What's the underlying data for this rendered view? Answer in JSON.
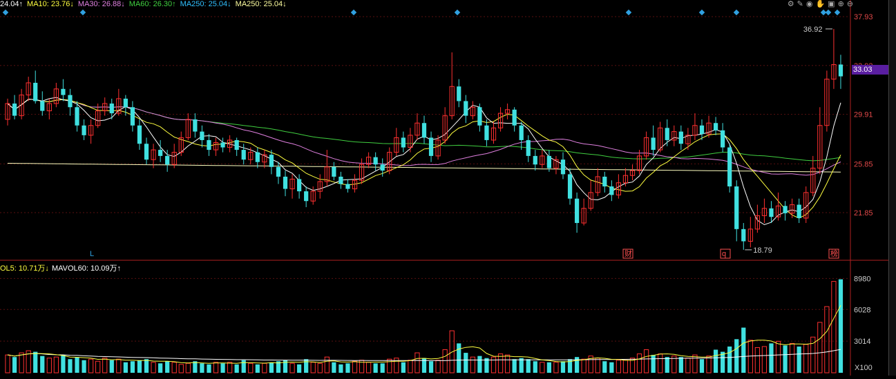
{
  "ma_legend": [
    {
      "text": "24.04↑",
      "color": "#ffffff"
    },
    {
      "text": "MA10: 23.76↓",
      "color": "#ffff40"
    },
    {
      "text": "MA30: 26.88↓",
      "color": "#e080e0"
    },
    {
      "text": "MA60: 26.30↑",
      "color": "#40d040"
    },
    {
      "text": "MA250: 25.04↓",
      "color": "#30c0ff"
    },
    {
      "text": "MA250: 25.04↓",
      "color": "#ffffa0"
    }
  ],
  "vol_legend": [
    {
      "text": "OL5: 10.71万↓",
      "color": "#ffff40"
    },
    {
      "text": "MAVOL60: 10.09万↑",
      "color": "#ffffff"
    }
  ],
  "chart_data": {
    "type": "candlestick",
    "y_ticks": [
      "37.93",
      "33.92",
      "29.91",
      "25.85",
      "21.85"
    ],
    "current_price": "33.03",
    "high_marker": "36.92",
    "low_marker": "18.79",
    "event_labels": [
      "L",
      "财",
      "q",
      "榜"
    ],
    "volume_ticks": [
      "8980",
      "6028",
      "3014"
    ],
    "volume_unit": "X100",
    "candles": [
      [
        29.5,
        30.8,
        31.2,
        29.0
      ],
      [
        30.8,
        29.8,
        31.5,
        29.5
      ],
      [
        29.8,
        31.5,
        32.0,
        29.5
      ],
      [
        31.5,
        32.5,
        33.0,
        31.0
      ],
      [
        32.5,
        31.0,
        33.5,
        30.8
      ],
      [
        31.0,
        30.2,
        31.8,
        29.8
      ],
      [
        30.2,
        30.8,
        31.2,
        29.5
      ],
      [
        30.8,
        32.0,
        32.5,
        30.5
      ],
      [
        32.0,
        31.5,
        32.8,
        31.0
      ],
      [
        31.5,
        30.5,
        32.0,
        29.8
      ],
      [
        30.5,
        29.0,
        31.0,
        28.5
      ],
      [
        29.0,
        28.2,
        29.5,
        27.8
      ],
      [
        28.2,
        29.0,
        29.5,
        27.5
      ],
      [
        29.0,
        30.2,
        30.8,
        28.8
      ],
      [
        30.2,
        30.8,
        31.3,
        29.8
      ],
      [
        30.8,
        30.0,
        31.2,
        29.5
      ],
      [
        30.0,
        31.2,
        32.0,
        29.8
      ],
      [
        31.2,
        30.5,
        31.5,
        29.8
      ],
      [
        30.5,
        29.0,
        31.0,
        28.5
      ],
      [
        29.0,
        27.5,
        29.5,
        27.0
      ],
      [
        27.5,
        26.2,
        28.0,
        25.8
      ],
      [
        26.2,
        27.0,
        27.5,
        25.5
      ],
      [
        27.0,
        26.5,
        27.8,
        26.0
      ],
      [
        26.5,
        25.8,
        27.0,
        25.2
      ],
      [
        25.8,
        26.8,
        27.5,
        25.5
      ],
      [
        26.8,
        28.0,
        28.5,
        26.5
      ],
      [
        28.0,
        29.5,
        30.0,
        27.8
      ],
      [
        29.5,
        28.5,
        30.0,
        28.0
      ],
      [
        28.5,
        27.8,
        29.0,
        27.2
      ],
      [
        27.8,
        27.0,
        28.3,
        26.5
      ],
      [
        27.0,
        27.6,
        28.0,
        26.5
      ],
      [
        27.6,
        27.2,
        28.0,
        26.8
      ],
      [
        27.2,
        27.8,
        28.2,
        26.8
      ],
      [
        27.8,
        27.0,
        28.0,
        26.5
      ],
      [
        27.0,
        26.2,
        27.5,
        25.8
      ],
      [
        26.2,
        26.8,
        27.2,
        25.8
      ],
      [
        26.8,
        26.0,
        27.2,
        25.5
      ],
      [
        26.0,
        26.6,
        27.0,
        25.5
      ],
      [
        26.6,
        25.6,
        27.0,
        25.0
      ],
      [
        25.6,
        24.8,
        26.0,
        24.2
      ],
      [
        24.8,
        23.8,
        25.3,
        23.2
      ],
      [
        23.8,
        24.6,
        25.0,
        23.0
      ],
      [
        24.6,
        23.6,
        25.0,
        23.0
      ],
      [
        23.6,
        22.8,
        24.0,
        22.3
      ],
      [
        22.8,
        23.6,
        24.0,
        22.5
      ],
      [
        23.6,
        24.4,
        25.0,
        23.0
      ],
      [
        24.4,
        25.6,
        27.0,
        24.0
      ],
      [
        25.6,
        24.8,
        26.0,
        24.5
      ],
      [
        24.8,
        24.2,
        25.2,
        23.8
      ],
      [
        24.2,
        23.8,
        24.6,
        23.5
      ],
      [
        23.8,
        24.5,
        25.0,
        23.5
      ],
      [
        24.5,
        25.8,
        26.3,
        24.2
      ],
      [
        25.8,
        26.4,
        26.8,
        25.5
      ],
      [
        26.4,
        25.8,
        26.8,
        25.3
      ],
      [
        25.8,
        25.3,
        26.3,
        24.8
      ],
      [
        25.3,
        26.8,
        27.2,
        25.0
      ],
      [
        26.8,
        28.0,
        28.8,
        26.5
      ],
      [
        28.0,
        27.2,
        28.5,
        26.8
      ],
      [
        27.2,
        28.2,
        28.8,
        26.8
      ],
      [
        28.2,
        29.2,
        30.0,
        27.8
      ],
      [
        29.2,
        28.0,
        29.8,
        27.5
      ],
      [
        28.0,
        26.5,
        28.5,
        26.0
      ],
      [
        26.5,
        27.8,
        28.2,
        26.2
      ],
      [
        27.8,
        29.8,
        30.5,
        27.5
      ],
      [
        29.8,
        32.2,
        35.0,
        29.5
      ],
      [
        32.2,
        31.0,
        32.8,
        30.5
      ],
      [
        31.0,
        29.8,
        31.5,
        29.2
      ],
      [
        29.8,
        30.5,
        31.0,
        29.5
      ],
      [
        30.5,
        29.0,
        30.8,
        28.5
      ],
      [
        29.0,
        27.8,
        29.5,
        27.3
      ],
      [
        27.8,
        28.8,
        29.3,
        27.5
      ],
      [
        28.8,
        30.0,
        30.5,
        28.5
      ],
      [
        30.0,
        30.3,
        30.8,
        29.5
      ],
      [
        30.3,
        29.0,
        30.5,
        28.5
      ],
      [
        29.0,
        27.8,
        29.3,
        27.0
      ],
      [
        27.8,
        26.5,
        28.2,
        26.0
      ],
      [
        26.5,
        25.8,
        27.0,
        25.3
      ],
      [
        25.8,
        26.5,
        27.0,
        25.5
      ],
      [
        26.5,
        25.5,
        27.0,
        25.2
      ],
      [
        25.5,
        26.2,
        26.5,
        25.0
      ],
      [
        26.2,
        25.0,
        26.8,
        24.6
      ],
      [
        25.0,
        23.0,
        25.5,
        22.5
      ],
      [
        23.0,
        21.0,
        23.5,
        20.2
      ],
      [
        21.0,
        22.2,
        23.0,
        20.8
      ],
      [
        22.2,
        23.5,
        24.5,
        22.0
      ],
      [
        23.5,
        24.8,
        25.5,
        23.2
      ],
      [
        24.8,
        24.0,
        25.2,
        23.5
      ],
      [
        24.0,
        23.3,
        24.5,
        22.8
      ],
      [
        23.3,
        24.3,
        25.0,
        23.0
      ],
      [
        24.3,
        24.9,
        25.5,
        24.0
      ],
      [
        24.9,
        25.3,
        25.8,
        24.5
      ],
      [
        25.3,
        26.5,
        27.0,
        25.0
      ],
      [
        26.5,
        28.0,
        28.5,
        26.2
      ],
      [
        28.0,
        27.0,
        29.0,
        26.5
      ],
      [
        27.0,
        28.8,
        29.3,
        26.8
      ],
      [
        28.8,
        27.8,
        29.5,
        27.3
      ],
      [
        27.8,
        28.5,
        29.0,
        27.3
      ],
      [
        28.5,
        27.5,
        29.0,
        27.0
      ],
      [
        27.5,
        28.2,
        28.8,
        27.0
      ],
      [
        28.2,
        29.0,
        30.0,
        27.8
      ],
      [
        29.0,
        28.3,
        29.5,
        27.8
      ],
      [
        28.3,
        29.2,
        29.8,
        28.0
      ],
      [
        29.2,
        28.6,
        29.7,
        28.2
      ],
      [
        28.6,
        27.2,
        29.2,
        26.8
      ],
      [
        27.2,
        24.0,
        27.5,
        23.5
      ],
      [
        24.0,
        20.5,
        24.5,
        19.5
      ],
      [
        20.5,
        19.5,
        21.0,
        18.8
      ],
      [
        19.5,
        20.5,
        21.5,
        19.0
      ],
      [
        20.5,
        21.6,
        22.5,
        20.2
      ],
      [
        21.6,
        22.2,
        23.0,
        21.0
      ],
      [
        22.2,
        21.5,
        22.8,
        21.0
      ],
      [
        21.5,
        22.4,
        23.5,
        21.2
      ],
      [
        22.4,
        21.8,
        22.8,
        21.2
      ],
      [
        21.8,
        22.5,
        23.0,
        21.4
      ],
      [
        22.5,
        21.4,
        23.0,
        21.0
      ],
      [
        21.4,
        23.5,
        24.0,
        21.0
      ],
      [
        23.5,
        25.5,
        26.5,
        23.2
      ],
      [
        25.5,
        29.0,
        30.5,
        25.0
      ],
      [
        29.0,
        32.8,
        33.5,
        28.5
      ],
      [
        32.8,
        34.0,
        36.92,
        32.0
      ],
      [
        34.0,
        33.03,
        34.8,
        32.0
      ]
    ],
    "volumes": [
      1700,
      1500,
      1900,
      2100,
      2000,
      1600,
      1400,
      1500,
      1700,
      1300,
      1500,
      1200,
      1300,
      1100,
      1400,
      1200,
      1300,
      1000,
      1100,
      1200,
      1300,
      1000,
      900,
      1100,
      1000,
      800,
      900,
      1100,
      900,
      800,
      1000,
      900,
      1000,
      800,
      1200,
      900,
      800,
      900,
      1000,
      1100,
      1200,
      900,
      800,
      1300,
      1000,
      900,
      1500,
      1000,
      800,
      900,
      1100,
      1200,
      1000,
      900,
      900,
      1300,
      1400,
      1000,
      1200,
      1900,
      1400,
      1100,
      1200,
      2200,
      4000,
      2800,
      1900,
      1500,
      1600,
      1400,
      1500,
      1800,
      1700,
      1300,
      1400,
      1300,
      1100,
      1000,
      1000,
      1000,
      1100,
      1300,
      1500,
      1300,
      1600,
      1400,
      1100,
      1000,
      1200,
      1200,
      1400,
      1800,
      2200,
      1700,
      1800,
      1500,
      1600,
      1500,
      1400,
      1700,
      1300,
      1600,
      2200,
      2000,
      2500,
      3200,
      4300,
      3100,
      2400,
      2500,
      2800,
      3000,
      2600,
      2800,
      2500,
      2700,
      3400,
      4800,
      6300,
      8700,
      8900
    ]
  }
}
